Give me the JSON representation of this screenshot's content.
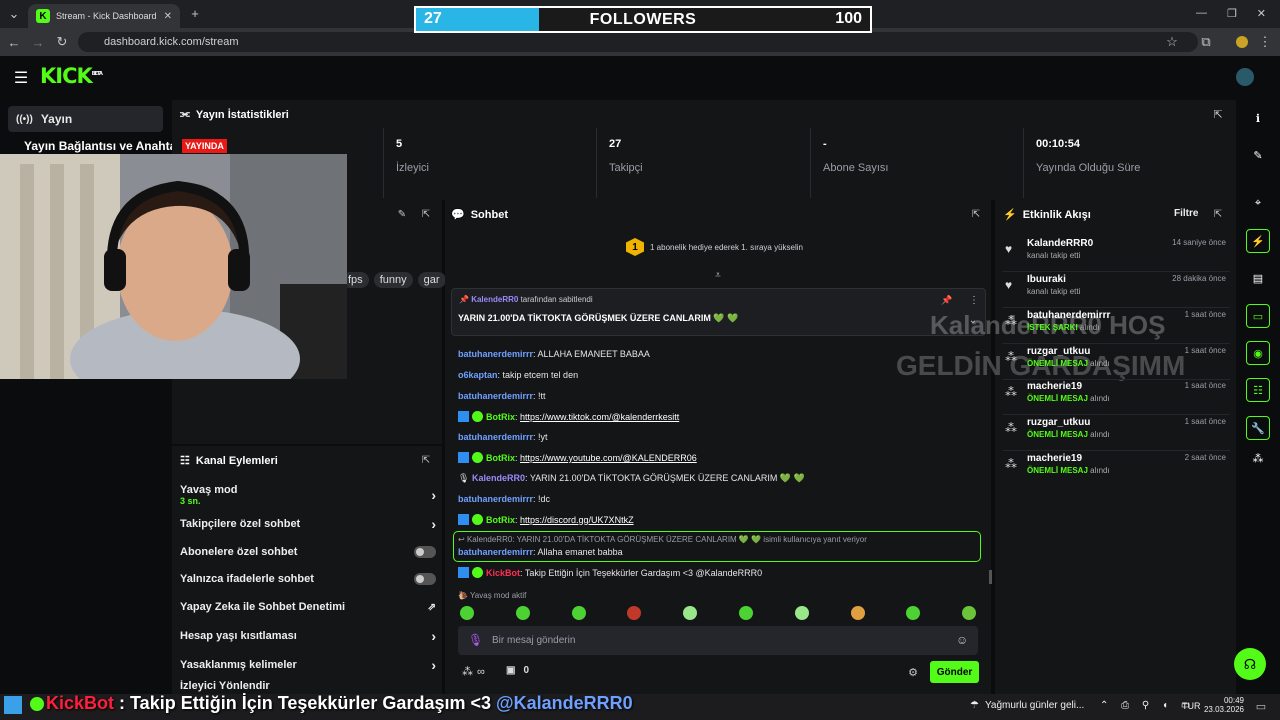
{
  "browser": {
    "tab_title": "Stream - Kick Dashboard",
    "url": "dashboard.kick.com/stream"
  },
  "follower_goal": {
    "current": "27",
    "label": "FOLLOWERS",
    "goal": "100",
    "progress_fraction": 0.27
  },
  "header": {
    "logo": "KICK",
    "logo_badge": "BETA"
  },
  "sidebar": {
    "items": [
      {
        "label": "Yayın"
      },
      {
        "label": "Yayın Bağlantısı ve Anahtarı"
      }
    ]
  },
  "stats": {
    "title": "Yayın İstatistikleri",
    "live_badge": "YAYINDA",
    "items": [
      {
        "value": "5",
        "label": "İzleyici"
      },
      {
        "value": "27",
        "label": "Takipçi"
      },
      {
        "value": "-",
        "label": "Abone Sayısı"
      },
      {
        "value": "00:10:54",
        "label": "Yayında Olduğu Süre"
      }
    ]
  },
  "preview": {
    "tags": [
      "fps",
      "funny",
      "gar"
    ]
  },
  "channel_actions": {
    "title": "Kanal Eylemleri",
    "items": [
      {
        "label": "Yavaş mod",
        "sub": "3 sn."
      },
      {
        "label": "Takipçilere özel sohbet"
      },
      {
        "label": "Abonelere özel sohbet"
      },
      {
        "label": "Yalnızca ifadelerle sohbet"
      },
      {
        "label": "Yapay Zeka ile Sohbet Denetimi"
      },
      {
        "label": "Hesap yaşı kısıtlaması"
      },
      {
        "label": "Yasaklanmış kelimeler"
      },
      {
        "label": "İzleyici Yönlendir"
      }
    ]
  },
  "chat": {
    "title": "Sohbet",
    "sub_rank": "1",
    "sub_promo": "1 abonelik hediye ederek 1. sıraya yükselin",
    "pinned_by_user": "KalendeRR0",
    "pinned_by_text": "tarafından sabitlendi",
    "pinned_message": "YARIN 21.00'DA TİKTOKTA GÖRÜŞMEK ÜZERE CANLARIM 💚 💚",
    "messages": [
      {
        "user": "batuhanerdemirrr",
        "text": "ALLAHA EMANEET BABAA"
      },
      {
        "user": "o6kaptan",
        "text": "takip etcem tel den"
      },
      {
        "user": "batuhanerdemirrr",
        "text": "!tt"
      },
      {
        "user": "BotRix",
        "text": "https://www.tiktok.com/@kalenderrkesitt"
      },
      {
        "user": "batuhanerdemirrr",
        "text": "!yt"
      },
      {
        "user": "BotRix",
        "text": "https://www.youtube.com/@KALENDERR06"
      },
      {
        "user": "KalendeRR0",
        "text": "YARIN 21.00'DA TİKTOKTA GÖRÜŞMEK ÜZERE CANLARIM 💚 💚"
      },
      {
        "user": "batuhanerdemirrr",
        "text": "!dc"
      },
      {
        "user": "BotRix",
        "text": "https://discord.gg/UK7XNtkZ"
      },
      {
        "user": "batuhanerdemirrr",
        "text": "Allaha emanet babba"
      },
      {
        "user": "KickBot",
        "text": "Takip Ettiğin İçin Teşekkürler Gardaşım <3 @KalandeRRR0"
      }
    ],
    "reply_context": "KalendeRR0: YARIN 21.00'DA TİKTOKTA GÖRÜŞMEK ÜZERE CANLARIM 💚 💚 isimli kullanıcıya yanıt veriyor",
    "slow_mode": "Yavaş mod aktif",
    "input_placeholder": "Bir mesaj gönderin",
    "points": "∞",
    "drops": "0",
    "send_label": "Gönder"
  },
  "activity": {
    "title": "Etkinlik Akışı",
    "filter": "Filtre",
    "events": [
      {
        "user": "KalandeRRR0",
        "sub_plain": "kanalı takip etti",
        "highlight": "",
        "time": "14 saniye önce"
      },
      {
        "user": "Ibuuraki",
        "sub_plain": "kanalı takip etti",
        "highlight": "",
        "time": "28 dakika önce"
      },
      {
        "user": "batuhanerdemirrr",
        "highlight": "İSTEK ŞARKI",
        "sub_plain": "alındı",
        "time": "1 saat önce"
      },
      {
        "user": "ruzgar_utkuu",
        "highlight": "ÖNEMLİ MESAJ",
        "sub_plain": "alındı",
        "time": "1 saat önce"
      },
      {
        "user": "macherie19",
        "highlight": "ÖNEMLİ MESAJ",
        "sub_plain": "alındı",
        "time": "1 saat önce"
      },
      {
        "user": "ruzgar_utkuu",
        "highlight": "ÖNEMLİ MESAJ",
        "sub_plain": "alındı",
        "time": "1 saat önce"
      },
      {
        "user": "macherie19",
        "highlight": "ÖNEMLİ MESAJ",
        "sub_plain": "alındı",
        "time": "2 saat önce"
      }
    ]
  },
  "overlay": {
    "watermark1": "KalandeRRR0 HOŞ",
    "watermark2": "GELDİN GARDAŞIMM",
    "ticker_bot": "KickBot",
    "ticker_text": ": Takip Ettiğin İçin Teşekkürler Gardaşım <3",
    "ticker_user": "@KalandeRRR0"
  },
  "taskbar": {
    "weather": "Yağmurlu günler geli...",
    "lang": "TUR",
    "time": "00:49",
    "date": "23.03.2026"
  }
}
